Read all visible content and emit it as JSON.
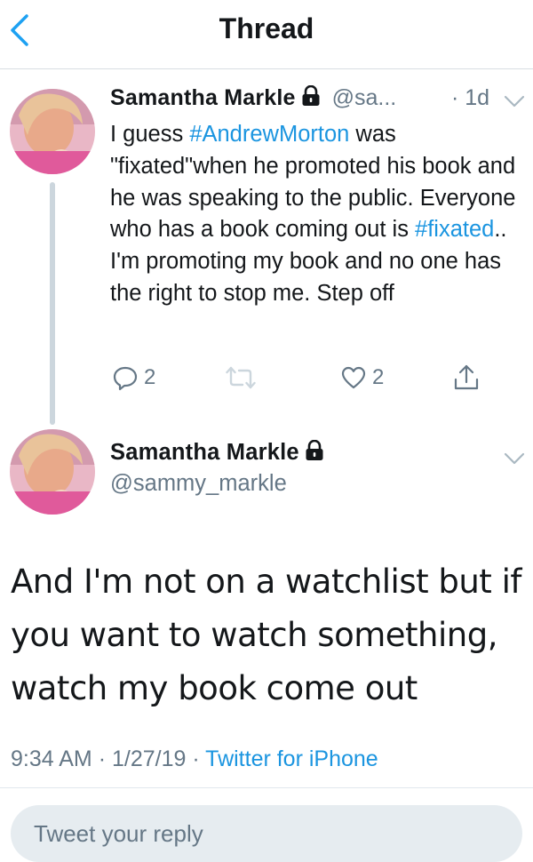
{
  "header": {
    "title": "Thread",
    "back_icon": "chevron-left-icon",
    "accent": "#1da1f2"
  },
  "tweets": [
    {
      "name": "Samantha  Markle",
      "handle": "@sa...",
      "time": "· 1d",
      "text": [
        "I guess ",
        "#AndrewMorton",
        " was \"fixated\"when he promoted his book and he was speaking to the public. Everyone who has a book coming out is ",
        "#fixated",
        ".. I'm promoting my book and no one has the right to stop me. Step off"
      ],
      "replies": "2",
      "likes": "2"
    },
    {
      "name": "Samantha  Markle",
      "handle": "@sammy_markle",
      "text": "And I'm not on a watchlist but if you want to watch something, watch my book come out",
      "time": "9:34 AM",
      "date": "1/27/19",
      "source": "Twitter for iPhone"
    }
  ],
  "reply": {
    "placeholder": "Tweet your reply"
  },
  "colors": {
    "link": "#1b95e0",
    "muted": "#657786",
    "text": "#14171a"
  }
}
